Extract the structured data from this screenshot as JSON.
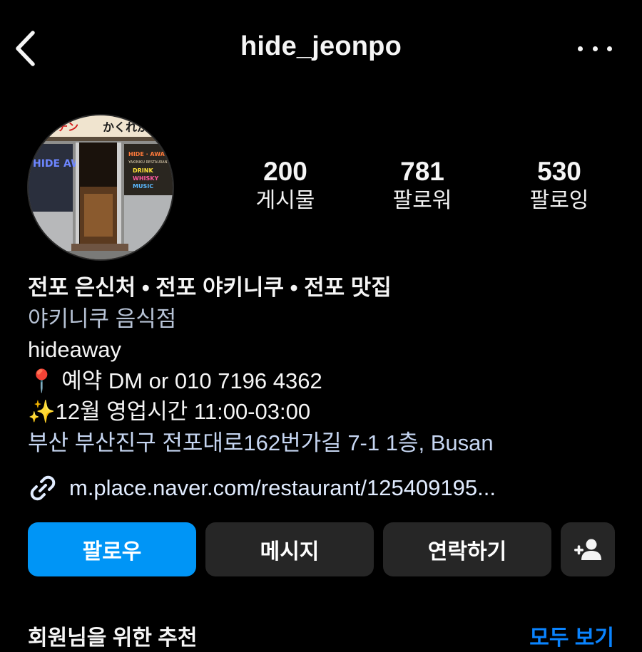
{
  "header": {
    "username": "hide_jeonpo",
    "back_icon": "chevron-left-icon",
    "more_icon": "more-horizontal-icon"
  },
  "avatar": {
    "sign_left": "チチチン",
    "sign_right": "かくれが",
    "sign_inner": "HIDE · AWAY",
    "sign_sub": "YAKINIKU RESTAURANT",
    "neon_left": "HIDE AWAY",
    "neon_right_1": "DRINK",
    "neon_right_2": "WHISKY",
    "neon_right_3": "MUSIC"
  },
  "stats": [
    {
      "value": "200",
      "label": "게시물"
    },
    {
      "value": "781",
      "label": "팔로워"
    },
    {
      "value": "530",
      "label": "팔로잉"
    }
  ],
  "bio": {
    "name": "전포 은신처 • 전포 야키니쿠 • 전포 맛집",
    "category": "야키니쿠 음식점",
    "line1": "hideaway",
    "line2": "📍 예약 DM or 010 7196 4362",
    "line3": "✨12월 영업시간 11:00-03:00",
    "address": "부산 부산진구 전포대로162번가길 7-1 1층, Busan",
    "link": "m.place.naver.com/restaurant/125409195..."
  },
  "actions": {
    "follow": "팔로우",
    "message": "메시지",
    "contact": "연락하기",
    "add_icon": "add-person-icon"
  },
  "recommendations": {
    "title": "회원님을 위한 추천",
    "see_all": "모두 보기"
  },
  "colors": {
    "background": "#000000",
    "primary_button": "#0095f6",
    "secondary_button": "#262626",
    "link": "#0a84ff"
  }
}
